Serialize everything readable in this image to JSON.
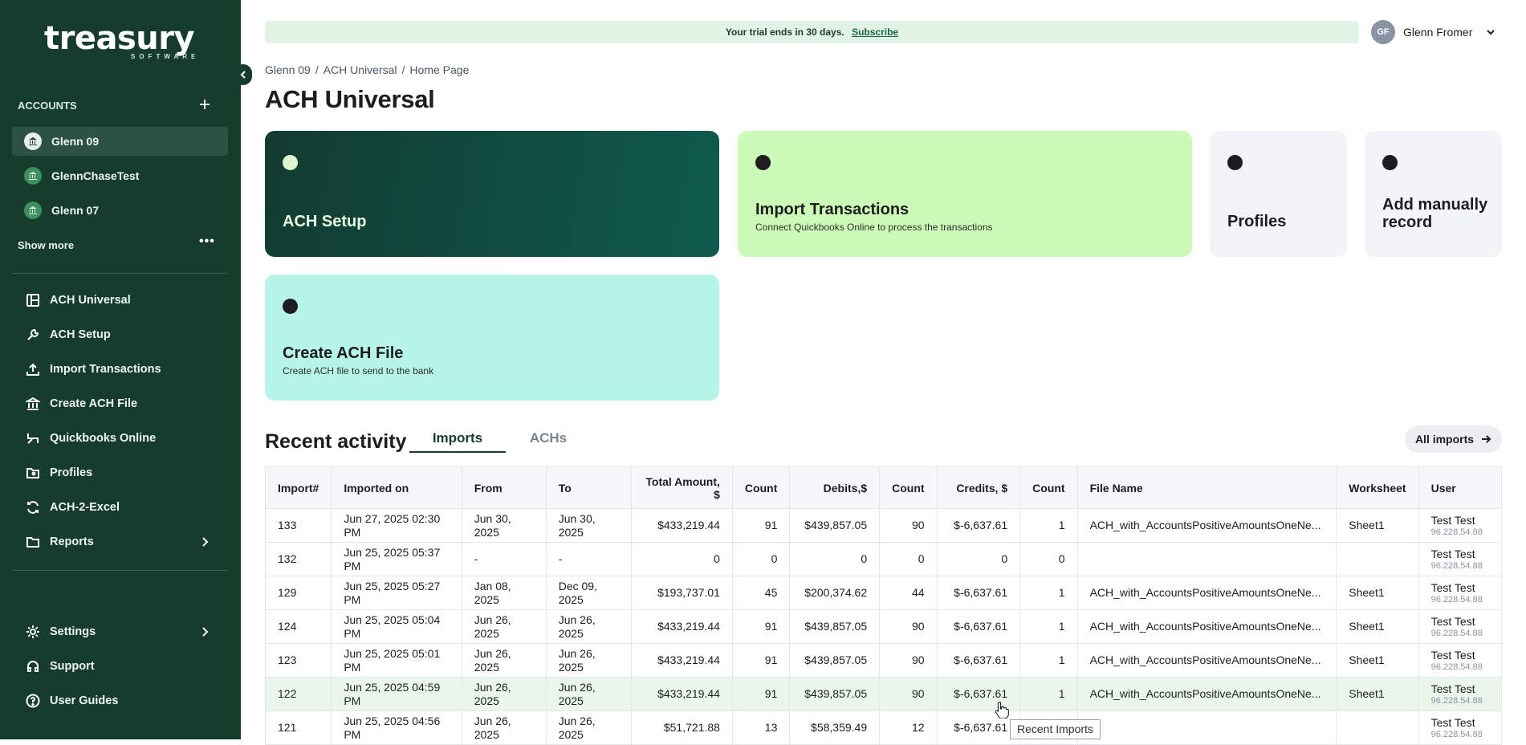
{
  "sidebar": {
    "logo_text": "treasury",
    "logo_sub": "SOFTWARE",
    "accounts_header": "ACCOUNTS",
    "accounts": [
      {
        "label": "Glenn 09",
        "active": true
      },
      {
        "label": "GlennChaseTest",
        "active": false
      },
      {
        "label": "Glenn 07",
        "active": false
      }
    ],
    "show_more": "Show more",
    "nav": [
      {
        "label": "ACH Universal",
        "icon": "dashboard-icon"
      },
      {
        "label": "ACH Setup",
        "icon": "wrench-icon"
      },
      {
        "label": "Import Transactions",
        "icon": "upload-icon"
      },
      {
        "label": "Create ACH File",
        "icon": "bank-icon"
      },
      {
        "label": "Quickbooks Online",
        "icon": "quickbooks-icon"
      },
      {
        "label": "Profiles",
        "icon": "profile-folder-icon"
      },
      {
        "label": "ACH-2-Excel",
        "icon": "sync-icon"
      },
      {
        "label": "Reports",
        "icon": "folder-icon"
      }
    ],
    "bottom_nav": [
      {
        "label": "Settings",
        "icon": "gear-icon"
      },
      {
        "label": "Support",
        "icon": "headset-icon"
      },
      {
        "label": "User Guides",
        "icon": "help-circle-icon"
      }
    ]
  },
  "header": {
    "trial_text": "Your trial ends in 30 days.",
    "trial_link": "Subscribe",
    "user_initials": "GF",
    "user_name": "Glenn Fromer"
  },
  "breadcrumb": [
    "Glenn 09",
    "ACH Universal",
    "Home Page"
  ],
  "page_title": "ACH Universal",
  "cards": [
    {
      "title": "ACH Setup",
      "subtitle": ""
    },
    {
      "title": "Import Transactions",
      "subtitle": "Connect Quickbooks Online to process the transactions"
    },
    {
      "title": "Profiles",
      "subtitle": ""
    },
    {
      "title": "Add manually record",
      "subtitle": ""
    },
    {
      "title": "Create ACH File",
      "subtitle": "Create ACH file to send to the bank"
    }
  ],
  "colors": {
    "sidebar_bg": "#163c2c",
    "card_ach_setup": "#0f5448",
    "card_import": "#ccfbb7",
    "card_light": "#f3f4f8",
    "card_create": "#b8f5e9",
    "trial_bg": "#e1f4e6",
    "row_highlight": "#eaf6ec"
  },
  "recent": {
    "title": "Recent activity",
    "tabs": [
      "Imports",
      "ACHs"
    ],
    "active_tab": "Imports",
    "all_imports": "All imports"
  },
  "table": {
    "columns": [
      "Import#",
      "Imported on",
      "From",
      "To",
      "Total Amount, $",
      "Count",
      "Debits,$",
      "Count",
      "Credits, $",
      "Count",
      "File Name",
      "Worksheet",
      "User"
    ],
    "rows": [
      [
        "133",
        "Jun 27, 2025 02:30 PM",
        "Jun 30, 2025",
        "Jun 30, 2025",
        "$433,219.44",
        "91",
        "$439,857.05",
        "90",
        "$-6,637.61",
        "1",
        "ACH_with_AccountsPositiveAmountsOneNe...",
        "Sheet1",
        "Test Test",
        "96.228.54.88"
      ],
      [
        "132",
        "Jun 25, 2025 05:37 PM",
        "-",
        "-",
        "0",
        "0",
        "0",
        "0",
        "0",
        "0",
        "",
        "",
        "Test Test",
        "96.228.54.88"
      ],
      [
        "129",
        "Jun 25, 2025 05:27 PM",
        "Jan 08, 2025",
        "Dec 09, 2025",
        "$193,737.01",
        "45",
        "$200,374.62",
        "44",
        "$-6,637.61",
        "1",
        "ACH_with_AccountsPositiveAmountsOneNe...",
        "Sheet1",
        "Test Test",
        "96.228.54.88"
      ],
      [
        "124",
        "Jun 25, 2025 05:04 PM",
        "Jun 26, 2025",
        "Jun 26, 2025",
        "$433,219.44",
        "91",
        "$439,857.05",
        "90",
        "$-6,637.61",
        "1",
        "ACH_with_AccountsPositiveAmountsOneNe...",
        "Sheet1",
        "Test Test",
        "96.228.54.88"
      ],
      [
        "123",
        "Jun 25, 2025 05:01 PM",
        "Jun 26, 2025",
        "Jun 26, 2025",
        "$433,219.44",
        "91",
        "$439,857.05",
        "90",
        "$-6,637.61",
        "1",
        "ACH_with_AccountsPositiveAmountsOneNe...",
        "Sheet1",
        "Test Test",
        "96.228.54.88"
      ],
      [
        "122",
        "Jun 25, 2025 04:59 PM",
        "Jun 26, 2025",
        "Jun 26, 2025",
        "$433,219.44",
        "91",
        "$439,857.05",
        "90",
        "$-6,637.61",
        "1",
        "ACH_with_AccountsPositiveAmountsOneNe...",
        "Sheet1",
        "Test Test",
        "96.228.54.88"
      ],
      [
        "121",
        "Jun 25, 2025 04:56 PM",
        "Jun 26, 2025",
        "Jun 26, 2025",
        "$51,721.88",
        "13",
        "$58,359.49",
        "12",
        "$-6,637.61",
        "",
        "",
        "",
        "Test Test",
        "96.228.54.88"
      ]
    ],
    "highlighted_row": 5
  },
  "tooltip": "Recent Imports"
}
